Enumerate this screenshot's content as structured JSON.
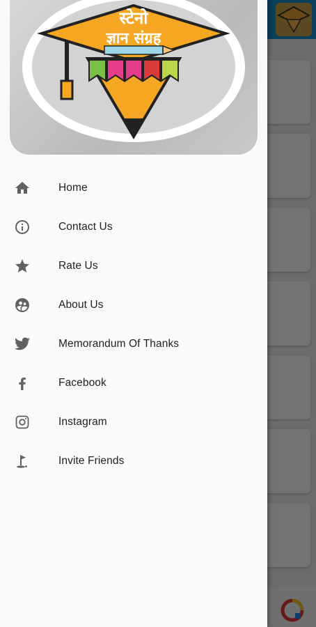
{
  "drawer": {
    "header": {
      "logo_line1": "स्टेनो",
      "logo_line2": "ज्ञान संग्रह",
      "logo_icon": "graduation-cap-pencil-logo"
    },
    "items": [
      {
        "label": "Home",
        "icon": "home-icon"
      },
      {
        "label": "Contact Us",
        "icon": "info-icon"
      },
      {
        "label": "Rate Us",
        "icon": "star-icon"
      },
      {
        "label": "About Us",
        "icon": "group-icon"
      },
      {
        "label": "Memorandum Of Thanks",
        "icon": "twitter-bird-icon"
      },
      {
        "label": "Facebook",
        "icon": "facebook-icon"
      },
      {
        "label": "Instagram",
        "icon": "instagram-icon"
      },
      {
        "label": "Invite Friends",
        "icon": "golf-flag-icon"
      }
    ]
  },
  "colors": {
    "drawer_background": "#fafafa",
    "icon_gray": "#616161",
    "label_text": "#212121",
    "appbar_blue": "#1a8ccc",
    "logo_orange": "#f5a623"
  }
}
